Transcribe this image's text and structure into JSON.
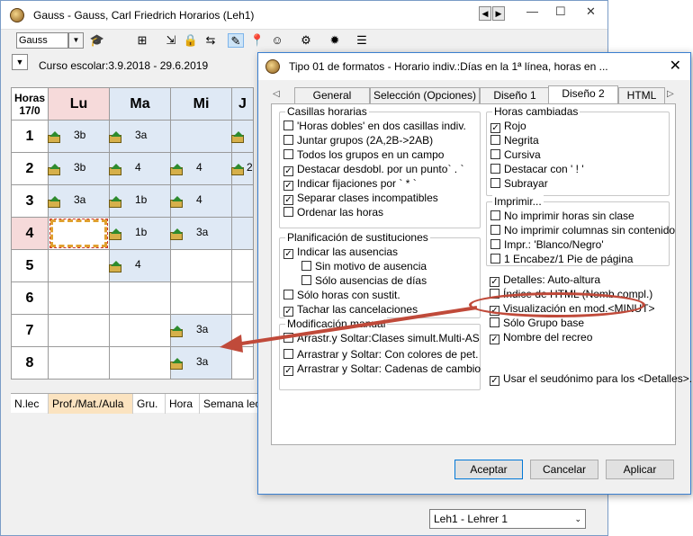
{
  "main": {
    "title": "Gauss - Gauss, Carl Friedrich  Horarios  (Leh1)",
    "combo_value": "Gauss",
    "school_year": "Curso escolar:3.9.2018 - 29.6.2019",
    "corner_line1": "Horas",
    "corner_line2": "17/0",
    "days": [
      "Lu",
      "Ma",
      "Mi",
      "J"
    ],
    "hours": [
      "1",
      "2",
      "3",
      "4",
      "5",
      "6",
      "7",
      "8"
    ],
    "cells": {
      "r1c1": "3b",
      "r1c2": "3a",
      "r2c1": "3b",
      "r2c2": "4",
      "r2c3": "4",
      "r2c4": "2",
      "r3c1": "3a",
      "r3c2": "1b",
      "r3c3": "4",
      "r4c2": "1b",
      "r4c3": "3a",
      "r5c2": "4",
      "r7c3": "3a",
      "r8c3": "3a"
    },
    "bottom_cols": [
      "N.lec",
      "Prof./Mat./Aula",
      "Gru.",
      "Hora",
      "Semana lec"
    ],
    "status_combo": "Leh1 - Lehrer 1"
  },
  "dialog": {
    "title": "Tipo 01 de formatos - Horario indiv.:Días en la 1ª línea, horas en ...",
    "tabs": [
      "General",
      "Selección (Opciones)",
      "Diseño 1",
      "Diseño 2",
      "HTML"
    ],
    "casillas": {
      "title": "Casillas horarias",
      "items": [
        {
          "label": "'Horas dobles' en dos casillas indiv.",
          "checked": false
        },
        {
          "label": "Juntar grupos (2A,2B->2AB)",
          "checked": false
        },
        {
          "label": "Todos los grupos en un campo",
          "checked": false
        },
        {
          "label": "Destacar desdobl. por un punto` . `",
          "checked": true
        },
        {
          "label": "Indicar fijaciones por ` * `",
          "checked": true
        },
        {
          "label": "Separar clases incompatibles",
          "checked": true
        },
        {
          "label": "Ordenar las horas",
          "checked": false
        }
      ]
    },
    "planificacion": {
      "title": "Planificación de sustituciones",
      "items": [
        {
          "label": "Indicar las ausencias",
          "checked": true
        },
        {
          "label": "Sin motivo de ausencia",
          "checked": false
        },
        {
          "label": "Sólo ausencias de días",
          "checked": false
        },
        {
          "label": "Sólo horas con sustit.",
          "checked": false
        },
        {
          "label": "Tachar las cancelaciones",
          "checked": true
        }
      ]
    },
    "modificacion": {
      "title": "Modificación manual",
      "items": [
        {
          "label": "Arrastr.y Soltar:Clases simult.Multi-AS",
          "checked": false
        },
        {
          "label": "Arrastrar y Soltar: Con colores de pet.",
          "checked": false
        },
        {
          "label": "Arrastrar y Soltar: Cadenas de cambio",
          "checked": true
        }
      ]
    },
    "horas_cambiadas": {
      "title": "Horas cambiadas",
      "items": [
        {
          "label": "Rojo",
          "checked": true
        },
        {
          "label": "Negrita",
          "checked": false
        },
        {
          "label": "Cursiva",
          "checked": false
        },
        {
          "label": "Destacar con ' ! '",
          "checked": false
        },
        {
          "label": "Subrayar",
          "checked": false
        }
      ]
    },
    "imprimir": {
      "title": "Imprimir...",
      "items": [
        {
          "label": "No imprimir horas sin clase",
          "checked": false
        },
        {
          "label": "No imprimir columnas sin contenido",
          "checked": false
        },
        {
          "label": "Impr.: 'Blanco/Negro'",
          "checked": false
        },
        {
          "label": "1 Encabez/1 Pie de página",
          "checked": false
        }
      ]
    },
    "misc": [
      {
        "label": "Detalles: Auto-altura",
        "checked": true
      },
      {
        "label": "Índice de HTML (Nomb.compl.)",
        "checked": false
      },
      {
        "label": "Visualización en mod.<MINUT>",
        "checked": true
      },
      {
        "label": "Sólo Grupo base",
        "checked": false
      },
      {
        "label": "Nombre del recreo",
        "checked": true
      }
    ],
    "seudonimo": {
      "label": "Usar el seudónimo para los <Detalles>.",
      "checked": true
    },
    "buttons": {
      "accept": "Aceptar",
      "cancel": "Cancelar",
      "apply": "Aplicar"
    }
  }
}
